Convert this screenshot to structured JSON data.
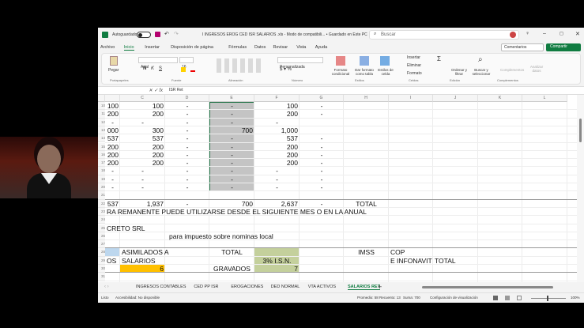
{
  "title_bar": {
    "autosave": "Autoguardado",
    "file_title": "I INGRESOS EROG CED ISR SALARIOS .xls  -  Modo de compatibili...  •  Guardado en Este PC",
    "search_placeholder": "Buscar"
  },
  "menu": [
    "Archivo",
    "Inicio",
    "Insertar",
    "Disposición de página",
    "Fórmulas",
    "Datos",
    "Revisar",
    "Vista",
    "Ayuda"
  ],
  "comments_label": "Comentarios",
  "share_label": "Compartir",
  "ribbon": {
    "paste": "Pegar",
    "font_name": "Arial",
    "font_size": "16",
    "number_format": "Personalizada",
    "cond_format": "Formato condicional",
    "table_format": "Dar formato como tabla",
    "cell_styles": "Estilos de celda",
    "insert": "Insertar",
    "delete": "Eliminar",
    "format": "Formato",
    "sort": "Ordenar y filtrar",
    "find": "Buscar y seleccionar",
    "addins": "Complementos",
    "analyze": "Analizar datos",
    "groups": [
      "Portapapeles",
      "Fuente",
      "Alineación",
      "Número",
      "Estilos",
      "Celdas",
      "Edición",
      "Complementos"
    ]
  },
  "formula_bar": {
    "cell_ref": "",
    "formula": "ISR Ret"
  },
  "columns": [
    "C",
    "D",
    "E",
    "F",
    "G",
    "H",
    "I",
    "J",
    "K",
    "L"
  ],
  "rows": [
    {
      "n": "10",
      "cells": {
        "B": "100",
        "C": "100",
        "D": "-",
        "E": "-",
        "F": "100",
        "G": "-"
      }
    },
    {
      "n": "11",
      "cells": {
        "B": "200",
        "C": "200",
        "D": "-",
        "E": "-",
        "F": "200",
        "G": "-"
      }
    },
    {
      "n": "12",
      "cells": {
        "B": "-",
        "C": "-",
        "D": "-",
        "E": "-",
        "F": "-"
      }
    },
    {
      "n": "13",
      "cells": {
        "B": "000",
        "C": "300",
        "D": "-",
        "E": "700",
        "F": "1,000"
      }
    },
    {
      "n": "14",
      "cells": {
        "B": "537",
        "C": "537",
        "D": "-",
        "E": "-",
        "F": "537",
        "G": "-"
      }
    },
    {
      "n": "15",
      "cells": {
        "B": "200",
        "C": "200",
        "D": "-",
        "E": "-",
        "F": "200",
        "G": "-"
      }
    },
    {
      "n": "16",
      "cells": {
        "B": "200",
        "C": "200",
        "D": "-",
        "E": "-",
        "F": "200",
        "G": "-"
      }
    },
    {
      "n": "17",
      "cells": {
        "B": "200",
        "C": "200",
        "D": "-",
        "E": "-",
        "F": "200",
        "G": "-"
      }
    },
    {
      "n": "18",
      "cells": {
        "B": "-",
        "C": "-",
        "D": "-",
        "E": "-",
        "F": "-",
        "G": "-"
      }
    },
    {
      "n": "19",
      "cells": {
        "B": "-",
        "C": "-",
        "D": "-",
        "E": "-",
        "F": "-",
        "G": "-"
      }
    },
    {
      "n": "20",
      "cells": {
        "B": "-",
        "C": "-",
        "D": "-",
        "E": "-",
        "F": "-",
        "G": "-"
      }
    },
    {
      "n": "21",
      "cells": {}
    },
    {
      "n": "22",
      "cells": {
        "B": "537",
        "C": "1,937",
        "D": "-",
        "E": "700",
        "F": "2,637",
        "G": "-",
        "H": "TOTAL"
      }
    },
    {
      "n": "23",
      "cells": {
        "B": "RA REMANENTE PUEDE UTILIZARSE DESDE EL SIGUIENTE MES O EN LA ANUAL"
      }
    },
    {
      "n": "24",
      "cells": {}
    },
    {
      "n": "25",
      "cells": {
        "B": "CRETO SRL"
      }
    },
    {
      "n": "26",
      "cells": {
        "D": "para impuesto sobre nominas local"
      }
    },
    {
      "n": "27",
      "cells": {}
    },
    {
      "n": "28",
      "cells": {
        "C": "ASIMILADOS A",
        "E": "TOTAL",
        "H": "IMSS",
        "I": "COP"
      }
    },
    {
      "n": "29",
      "cells": {
        "B": "OS",
        "C": "SALARIOS",
        "F": "3% I.S.N.",
        "I": "E INFONAVIT",
        "J": "TOTAL"
      }
    },
    {
      "n": "30",
      "cells": {
        "C": "6",
        "E": "GRAVADOS",
        "F": "7"
      }
    },
    {
      "n": "31",
      "cells": {}
    }
  ],
  "sheet_tabs": [
    "INGRESOS CONTABLES",
    "CED PP ISR",
    "EROGACIONES",
    "DED NORMAL",
    "VTA ACTIVOS",
    "SALARIOS RET"
  ],
  "active_tab": "SALARIOS RET",
  "status": {
    "ready": "Listo",
    "accessibility": "Accesibilidad: No disponible",
    "average": "Promedio: 58",
    "count": "Recuento: 13",
    "sum": "Suma: 700",
    "display_settings": "Configuración de visualización",
    "zoom": "100%"
  },
  "colors": {
    "excel_green": "#107c41",
    "selection": "#bdbdbd",
    "orange": "#ffc000",
    "olive": "#c4d09c",
    "blue": "#bdd7ee"
  }
}
